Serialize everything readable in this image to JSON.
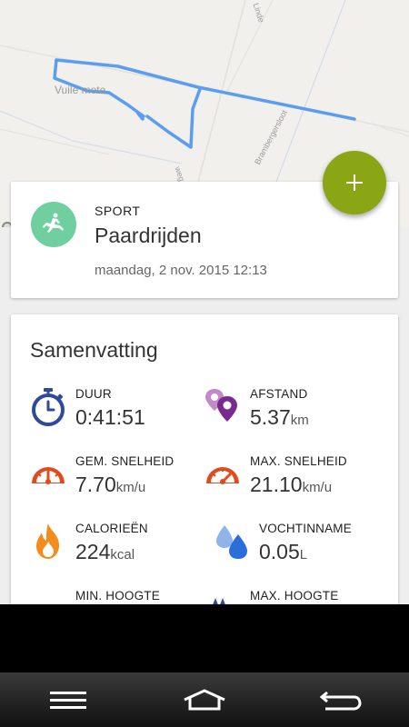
{
  "map": {
    "labels": {
      "vuile": "Vuile mote",
      "linde": "Linde",
      "brambergersloot": "Brambergersloot",
      "weg": "weg",
      "google": "gle"
    },
    "route_color": "#5b9ef0"
  },
  "fab": {
    "icon": "plus-icon",
    "color": "#8aa614"
  },
  "activity": {
    "sport_label": "SPORT",
    "sport_name": "Paardrijden",
    "date": "maandag, 2 nov. 2015 12:13",
    "icon": "horse-rider-icon",
    "icon_bg": "#6fcf9f"
  },
  "summary": {
    "title": "Samenvatting",
    "stats": [
      {
        "label": "DUUR",
        "value": "0:41:51",
        "unit": "",
        "icon": "stopwatch-icon"
      },
      {
        "label": "AFSTAND",
        "value": "5.37",
        "unit": "km",
        "icon": "location-pins-icon"
      },
      {
        "label": "GEM. SNELHEID",
        "value": "7.70",
        "unit": "km/u",
        "icon": "speedometer-avg-icon"
      },
      {
        "label": "MAX. SNELHEID",
        "value": "21.10",
        "unit": "km/u",
        "icon": "speedometer-max-icon"
      },
      {
        "label": "CALORIEËN",
        "value": "224",
        "unit": "kcal",
        "icon": "flame-icon"
      },
      {
        "label": "VOCHTINNAME",
        "value": "0.05",
        "unit": "L",
        "icon": "water-drops-icon"
      },
      {
        "label": "MIN. HOOGTE",
        "value": "",
        "unit": "",
        "icon": ""
      },
      {
        "label": "MAX. HOOGTE",
        "value": "",
        "unit": "",
        "icon": "mountain-icon"
      }
    ]
  },
  "nav": {
    "menu": "menu-icon",
    "home": "home-icon",
    "back": "back-icon"
  }
}
